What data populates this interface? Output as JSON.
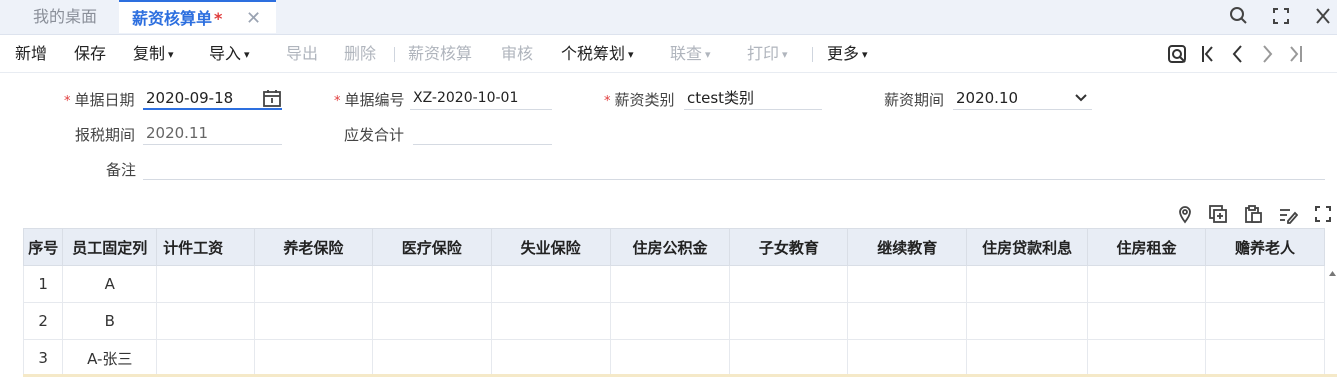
{
  "tabs": {
    "home_label": "我的桌面",
    "active_label": "薪资核算单",
    "dirty_mark": "*",
    "close_glyph": "✕"
  },
  "window": {
    "icons": [
      "search-icon",
      "fullscreen-icon",
      "close-icon"
    ]
  },
  "toolbar": {
    "add": "新增",
    "save": "保存",
    "copy": "复制",
    "import": "导入",
    "export": "导出",
    "delete": "删除",
    "calc": "薪资核算",
    "audit": "审核",
    "tax_plan": "个税筹划",
    "link_query": "联查",
    "print": "打印",
    "more": "更多",
    "chevron": "▾"
  },
  "form": {
    "date_label": "单据日期",
    "date_value": "2020-09-18",
    "number_label": "单据编号",
    "number_value": "XZ-2020-10-01",
    "category_label": "薪资类别",
    "category_value": "ctest类别",
    "period_label": "薪资期间",
    "period_value": "2020.10",
    "tax_period_label": "报税期间",
    "tax_period_value": "2020.11",
    "total_label": "应发合计",
    "total_value": "",
    "remark_label": "备注",
    "remark_value": "",
    "required_mark": "*"
  },
  "grid": {
    "columns": [
      "序号",
      "员工固定列",
      "计件工资",
      "养老保险",
      "医疗保险",
      "失业保险",
      "住房公积金",
      "子女教育",
      "继续教育",
      "住房贷款利息",
      "住房租金",
      "赡养老人"
    ],
    "rows": [
      {
        "seq": "1",
        "employee": "A"
      },
      {
        "seq": "2",
        "employee": "B"
      },
      {
        "seq": "3",
        "employee": "A-张三"
      }
    ]
  },
  "colors": {
    "accent": "#2d6fdf",
    "required": "#e03c3c",
    "header_bg": "#e8edf5"
  }
}
